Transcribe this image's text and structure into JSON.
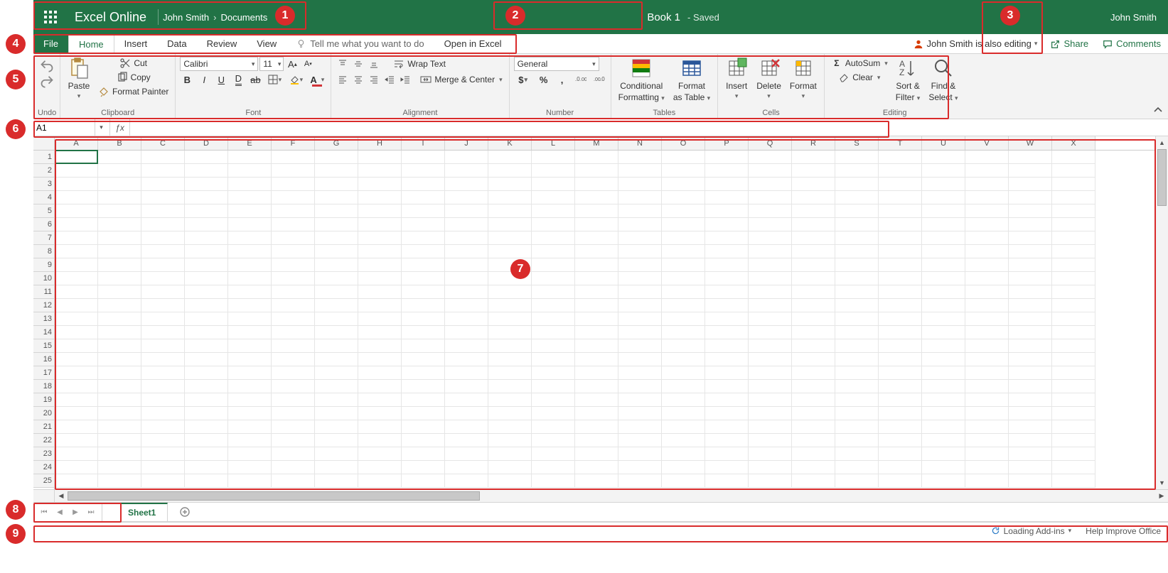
{
  "header": {
    "brand": "Excel Online",
    "breadcrumb_user": "John Smith",
    "breadcrumb_location": "Documents",
    "doc_title": "Book 1",
    "save_state": "Saved",
    "account": "John Smith"
  },
  "tabs": {
    "file": "File",
    "items": [
      "Home",
      "Insert",
      "Data",
      "Review",
      "View"
    ],
    "tell_me_placeholder": "Tell me what you want to do",
    "open_in_excel": "Open in Excel",
    "presence_text": "John Smith is also editing",
    "share": "Share",
    "comments": "Comments"
  },
  "ribbon": {
    "undo": {
      "label": "Undo"
    },
    "clipboard": {
      "label": "Clipboard",
      "paste": "Paste",
      "cut": "Cut",
      "copy": "Copy",
      "format_painter": "Format Painter"
    },
    "font": {
      "label": "Font",
      "name": "Calibri",
      "size": "11"
    },
    "alignment": {
      "label": "Alignment",
      "wrap": "Wrap Text",
      "merge": "Merge & Center"
    },
    "number": {
      "label": "Number",
      "format": "General"
    },
    "tables": {
      "label": "Tables",
      "conditional": "Conditional",
      "formatting": "Formatting",
      "format": "Format",
      "as_table": "as Table"
    },
    "cells": {
      "label": "Cells",
      "insert": "Insert",
      "delete": "Delete",
      "format": "Format"
    },
    "editing": {
      "label": "Editing",
      "autosum": "AutoSum",
      "clear": "Clear",
      "sort": "Sort &",
      "filter": "Filter",
      "find": "Find &",
      "select": "Select"
    }
  },
  "formula_bar": {
    "name_box": "A1",
    "formula": ""
  },
  "grid": {
    "columns": [
      "A",
      "B",
      "C",
      "D",
      "E",
      "F",
      "G",
      "H",
      "I",
      "J",
      "K",
      "L",
      "M",
      "N",
      "O",
      "P",
      "Q",
      "R",
      "S",
      "T",
      "U",
      "V",
      "W",
      "X"
    ],
    "rows": 25,
    "active_cell": "A1"
  },
  "sheets": {
    "active": "Sheet1"
  },
  "status": {
    "loading": "Loading Add-ins",
    "help": "Help Improve Office"
  },
  "callouts": {
    "1": "1",
    "2": "2",
    "3": "3",
    "4": "4",
    "5": "5",
    "6": "6",
    "7": "7",
    "8": "8",
    "9": "9"
  }
}
